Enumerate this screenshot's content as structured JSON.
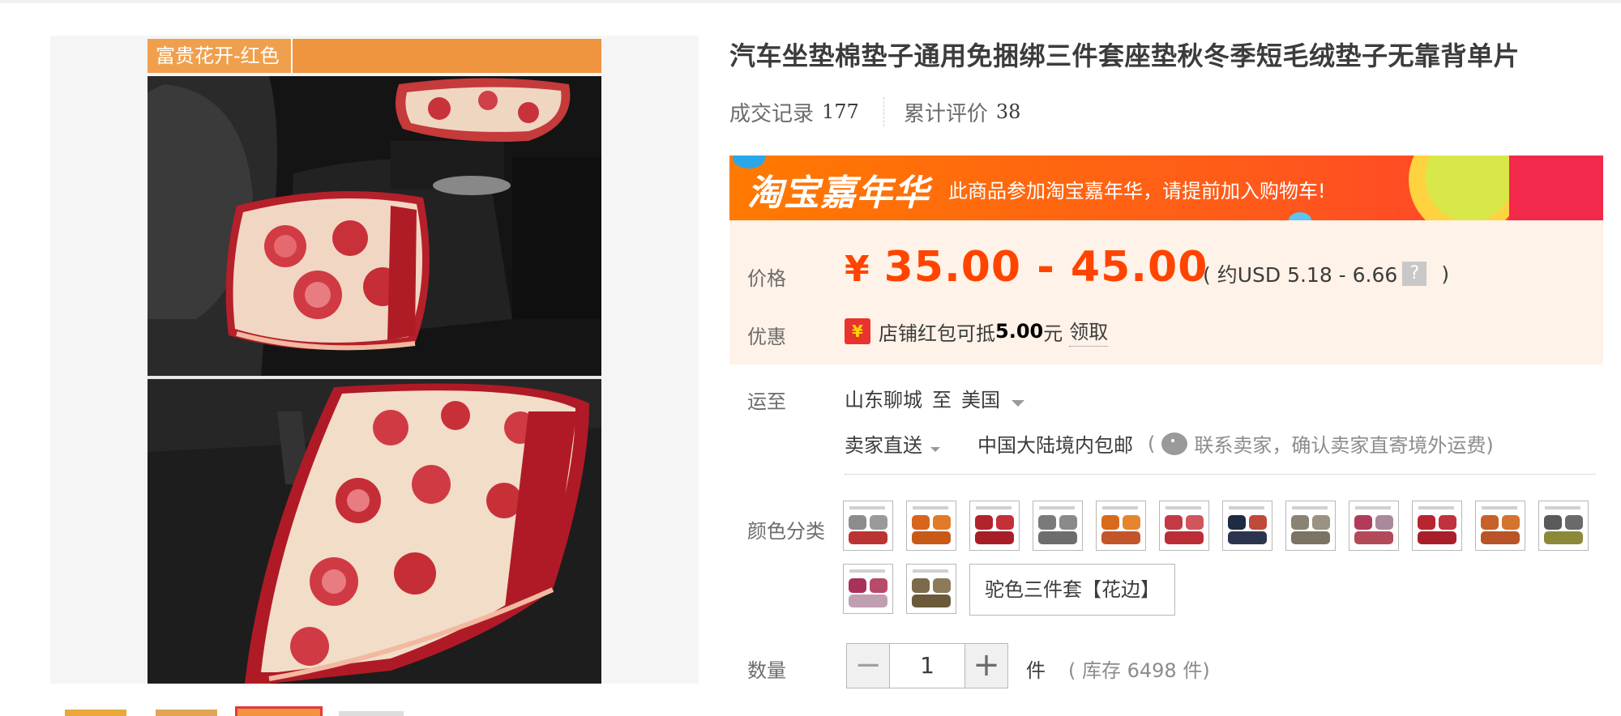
{
  "gallery": {
    "banner_tag": "富贵花开-红色"
  },
  "product": {
    "title": "汽车坐垫棉垫子通用免捆绑三件套座垫秋冬季短毛绒垫子无靠背单片",
    "stats": {
      "deals_label": "成交记录",
      "deals_count": "177",
      "reviews_label": "累计评价",
      "reviews_count": "38"
    }
  },
  "promo": {
    "logo": "淘宝嘉年华",
    "message": "此商品参加淘宝嘉年华，请提前加入购物车!"
  },
  "price": {
    "label": "价格",
    "currency": "¥",
    "range": "35.00 - 45.00",
    "usd_prefix": "( 约USD 5.18 - 6.66",
    "usd_help": "?",
    "usd_suffix": ")",
    "color": "#ff4400"
  },
  "discount": {
    "label": "优惠",
    "icon_glyph": "¥",
    "text_before": "店铺红包可抵",
    "amount": "5.00",
    "text_after": "元",
    "claim": "领取"
  },
  "shipping": {
    "label": "运至",
    "from": "山东聊城",
    "to_word": "至",
    "destination": "美国",
    "method": "卖家直送",
    "domestic": "中国大陆境内包邮",
    "paren_open": "(",
    "contact": "联系卖家，确认卖家直寄境外运费)"
  },
  "colors": {
    "label": "颜色分类",
    "swatches": [
      {
        "name": "swatch-1",
        "c1": "#8c8c8c",
        "c2": "#9a9a9a",
        "c3": "#b33"
      },
      {
        "name": "swatch-2",
        "c1": "#d8641e",
        "c2": "#e27a28",
        "c3": "#c85a18"
      },
      {
        "name": "swatch-3",
        "c1": "#b2242c",
        "c2": "#c3303a",
        "c3": "#a81e28"
      },
      {
        "name": "swatch-4",
        "c1": "#7a7a7a",
        "c2": "#8a8a8a",
        "c3": "#6d6d6d"
      },
      {
        "name": "swatch-5",
        "c1": "#d86a1e",
        "c2": "#e5862e",
        "c3": "#c2562a"
      },
      {
        "name": "swatch-6",
        "c1": "#c33a44",
        "c2": "#d0565c",
        "c3": "#bb2e38"
      },
      {
        "name": "swatch-7",
        "c1": "#1f2a44",
        "c2": "#c04a3a",
        "c3": "#2c3550"
      },
      {
        "name": "swatch-8",
        "c1": "#8a8272",
        "c2": "#9a9282",
        "c3": "#7b7363"
      },
      {
        "name": "swatch-9",
        "c1": "#b23a5a",
        "c2": "#a88a9a",
        "c3": "#b24a5a"
      },
      {
        "name": "swatch-10",
        "c1": "#b82430",
        "c2": "#c0323c",
        "c3": "#a81e2a"
      },
      {
        "name": "swatch-11",
        "c1": "#c8602a",
        "c2": "#d4742e",
        "c3": "#b85428"
      },
      {
        "name": "swatch-12",
        "c1": "#5a5a5a",
        "c2": "#6a6a6a",
        "c3": "#8a8a3a"
      },
      {
        "name": "swatch-13",
        "c1": "#a8325a",
        "c2": "#b84a6a",
        "c3": "#c0a0b0"
      },
      {
        "name": "swatch-14",
        "c1": "#7c6a4a",
        "c2": "#8c7a5a",
        "c3": "#6a5a3a"
      }
    ],
    "text_option": "驼色三件套【花边】"
  },
  "quantity": {
    "label": "数量",
    "minus": "−",
    "value": "1",
    "plus": "+",
    "unit": "件",
    "stock": "( 库存 6498 件)"
  }
}
